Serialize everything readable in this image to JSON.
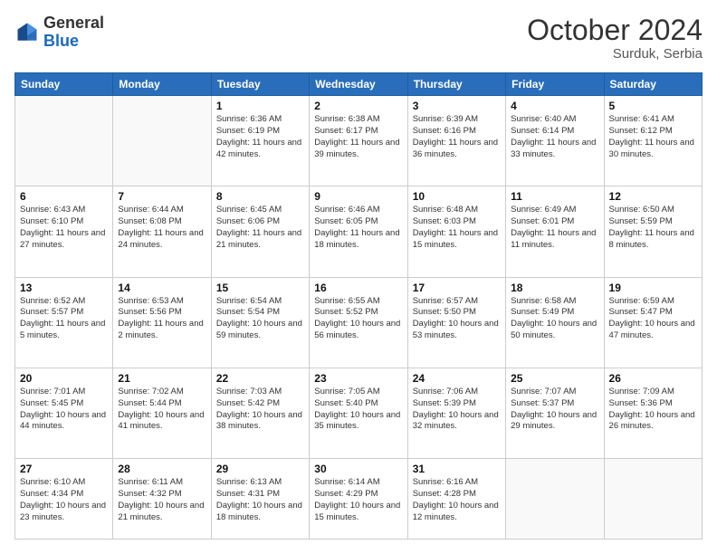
{
  "header": {
    "logo_general": "General",
    "logo_blue": "Blue",
    "month_title": "October 2024",
    "location": "Surduk, Serbia"
  },
  "weekdays": [
    "Sunday",
    "Monday",
    "Tuesday",
    "Wednesday",
    "Thursday",
    "Friday",
    "Saturday"
  ],
  "days": [
    {
      "num": "",
      "sunrise": "",
      "sunset": "",
      "daylight": "",
      "empty": true
    },
    {
      "num": "",
      "sunrise": "",
      "sunset": "",
      "daylight": "",
      "empty": true
    },
    {
      "num": "1",
      "sunrise": "Sunrise: 6:36 AM",
      "sunset": "Sunset: 6:19 PM",
      "daylight": "Daylight: 11 hours and 42 minutes."
    },
    {
      "num": "2",
      "sunrise": "Sunrise: 6:38 AM",
      "sunset": "Sunset: 6:17 PM",
      "daylight": "Daylight: 11 hours and 39 minutes."
    },
    {
      "num": "3",
      "sunrise": "Sunrise: 6:39 AM",
      "sunset": "Sunset: 6:16 PM",
      "daylight": "Daylight: 11 hours and 36 minutes."
    },
    {
      "num": "4",
      "sunrise": "Sunrise: 6:40 AM",
      "sunset": "Sunset: 6:14 PM",
      "daylight": "Daylight: 11 hours and 33 minutes."
    },
    {
      "num": "5",
      "sunrise": "Sunrise: 6:41 AM",
      "sunset": "Sunset: 6:12 PM",
      "daylight": "Daylight: 11 hours and 30 minutes."
    },
    {
      "num": "6",
      "sunrise": "Sunrise: 6:43 AM",
      "sunset": "Sunset: 6:10 PM",
      "daylight": "Daylight: 11 hours and 27 minutes."
    },
    {
      "num": "7",
      "sunrise": "Sunrise: 6:44 AM",
      "sunset": "Sunset: 6:08 PM",
      "daylight": "Daylight: 11 hours and 24 minutes."
    },
    {
      "num": "8",
      "sunrise": "Sunrise: 6:45 AM",
      "sunset": "Sunset: 6:06 PM",
      "daylight": "Daylight: 11 hours and 21 minutes."
    },
    {
      "num": "9",
      "sunrise": "Sunrise: 6:46 AM",
      "sunset": "Sunset: 6:05 PM",
      "daylight": "Daylight: 11 hours and 18 minutes."
    },
    {
      "num": "10",
      "sunrise": "Sunrise: 6:48 AM",
      "sunset": "Sunset: 6:03 PM",
      "daylight": "Daylight: 11 hours and 15 minutes."
    },
    {
      "num": "11",
      "sunrise": "Sunrise: 6:49 AM",
      "sunset": "Sunset: 6:01 PM",
      "daylight": "Daylight: 11 hours and 11 minutes."
    },
    {
      "num": "12",
      "sunrise": "Sunrise: 6:50 AM",
      "sunset": "Sunset: 5:59 PM",
      "daylight": "Daylight: 11 hours and 8 minutes."
    },
    {
      "num": "13",
      "sunrise": "Sunrise: 6:52 AM",
      "sunset": "Sunset: 5:57 PM",
      "daylight": "Daylight: 11 hours and 5 minutes."
    },
    {
      "num": "14",
      "sunrise": "Sunrise: 6:53 AM",
      "sunset": "Sunset: 5:56 PM",
      "daylight": "Daylight: 11 hours and 2 minutes."
    },
    {
      "num": "15",
      "sunrise": "Sunrise: 6:54 AM",
      "sunset": "Sunset: 5:54 PM",
      "daylight": "Daylight: 10 hours and 59 minutes."
    },
    {
      "num": "16",
      "sunrise": "Sunrise: 6:55 AM",
      "sunset": "Sunset: 5:52 PM",
      "daylight": "Daylight: 10 hours and 56 minutes."
    },
    {
      "num": "17",
      "sunrise": "Sunrise: 6:57 AM",
      "sunset": "Sunset: 5:50 PM",
      "daylight": "Daylight: 10 hours and 53 minutes."
    },
    {
      "num": "18",
      "sunrise": "Sunrise: 6:58 AM",
      "sunset": "Sunset: 5:49 PM",
      "daylight": "Daylight: 10 hours and 50 minutes."
    },
    {
      "num": "19",
      "sunrise": "Sunrise: 6:59 AM",
      "sunset": "Sunset: 5:47 PM",
      "daylight": "Daylight: 10 hours and 47 minutes."
    },
    {
      "num": "20",
      "sunrise": "Sunrise: 7:01 AM",
      "sunset": "Sunset: 5:45 PM",
      "daylight": "Daylight: 10 hours and 44 minutes."
    },
    {
      "num": "21",
      "sunrise": "Sunrise: 7:02 AM",
      "sunset": "Sunset: 5:44 PM",
      "daylight": "Daylight: 10 hours and 41 minutes."
    },
    {
      "num": "22",
      "sunrise": "Sunrise: 7:03 AM",
      "sunset": "Sunset: 5:42 PM",
      "daylight": "Daylight: 10 hours and 38 minutes."
    },
    {
      "num": "23",
      "sunrise": "Sunrise: 7:05 AM",
      "sunset": "Sunset: 5:40 PM",
      "daylight": "Daylight: 10 hours and 35 minutes."
    },
    {
      "num": "24",
      "sunrise": "Sunrise: 7:06 AM",
      "sunset": "Sunset: 5:39 PM",
      "daylight": "Daylight: 10 hours and 32 minutes."
    },
    {
      "num": "25",
      "sunrise": "Sunrise: 7:07 AM",
      "sunset": "Sunset: 5:37 PM",
      "daylight": "Daylight: 10 hours and 29 minutes."
    },
    {
      "num": "26",
      "sunrise": "Sunrise: 7:09 AM",
      "sunset": "Sunset: 5:36 PM",
      "daylight": "Daylight: 10 hours and 26 minutes."
    },
    {
      "num": "27",
      "sunrise": "Sunrise: 6:10 AM",
      "sunset": "Sunset: 4:34 PM",
      "daylight": "Daylight: 10 hours and 23 minutes."
    },
    {
      "num": "28",
      "sunrise": "Sunrise: 6:11 AM",
      "sunset": "Sunset: 4:32 PM",
      "daylight": "Daylight: 10 hours and 21 minutes."
    },
    {
      "num": "29",
      "sunrise": "Sunrise: 6:13 AM",
      "sunset": "Sunset: 4:31 PM",
      "daylight": "Daylight: 10 hours and 18 minutes."
    },
    {
      "num": "30",
      "sunrise": "Sunrise: 6:14 AM",
      "sunset": "Sunset: 4:29 PM",
      "daylight": "Daylight: 10 hours and 15 minutes."
    },
    {
      "num": "31",
      "sunrise": "Sunrise: 6:16 AM",
      "sunset": "Sunset: 4:28 PM",
      "daylight": "Daylight: 10 hours and 12 minutes."
    },
    {
      "num": "",
      "sunrise": "",
      "sunset": "",
      "daylight": "",
      "empty": true
    },
    {
      "num": "",
      "sunrise": "",
      "sunset": "",
      "daylight": "",
      "empty": true
    }
  ]
}
